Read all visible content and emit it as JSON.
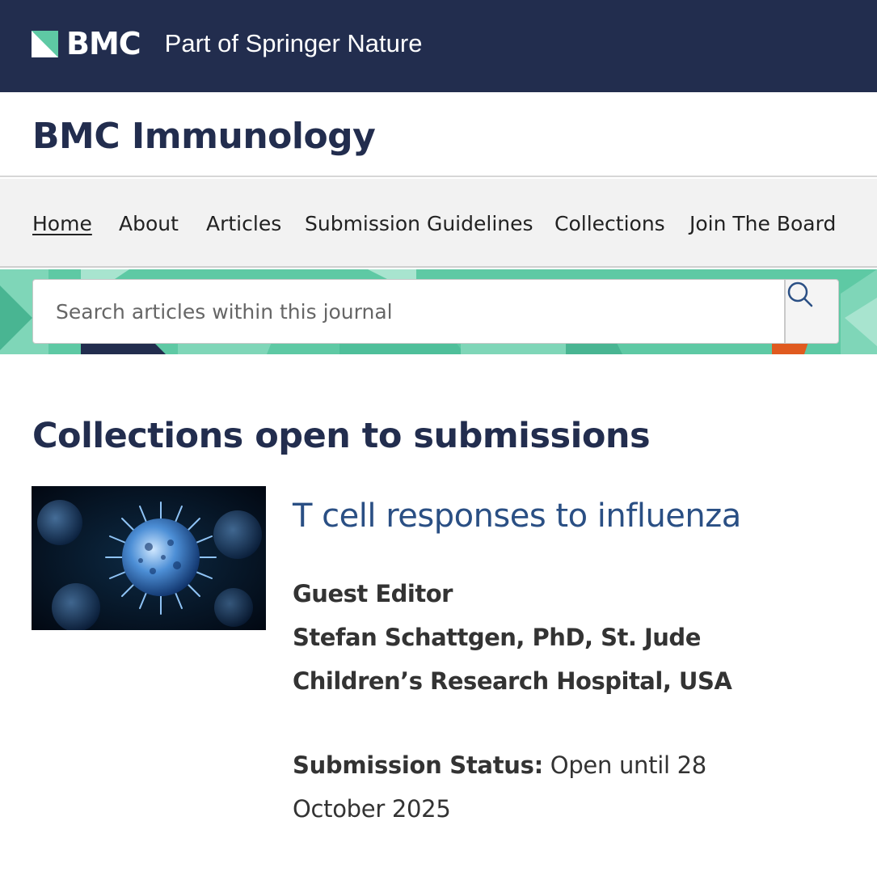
{
  "header": {
    "brand_name": "BMC",
    "brand_tagline": "Part of Springer Nature",
    "colors": {
      "navy": "#222d4e",
      "mint": "#5ec9a4"
    }
  },
  "journal": {
    "title": "BMC Immunology"
  },
  "nav": {
    "items": [
      {
        "label": "Home",
        "active": true
      },
      {
        "label": "About",
        "active": false
      },
      {
        "label": "Articles",
        "active": false
      },
      {
        "label": "Submission Guidelines",
        "active": false
      },
      {
        "label": "Collections",
        "active": false
      },
      {
        "label": "Join The Board",
        "active": false
      }
    ]
  },
  "search": {
    "placeholder": "Search articles within this journal",
    "icon": "search-icon"
  },
  "main": {
    "section_title": "Collections open to submissions",
    "collection": {
      "image": "virus-illustration",
      "title": "T cell responses to influenza",
      "editor_heading": "Guest Editor",
      "editor_line1": "Stefan Schattgen, PhD, St. Jude",
      "editor_line2": "Children’s Research Hospital, USA",
      "status_label": "Submission Status:",
      "status_value_line1": " Open until 28",
      "status_value_line2": "October 2025"
    }
  }
}
